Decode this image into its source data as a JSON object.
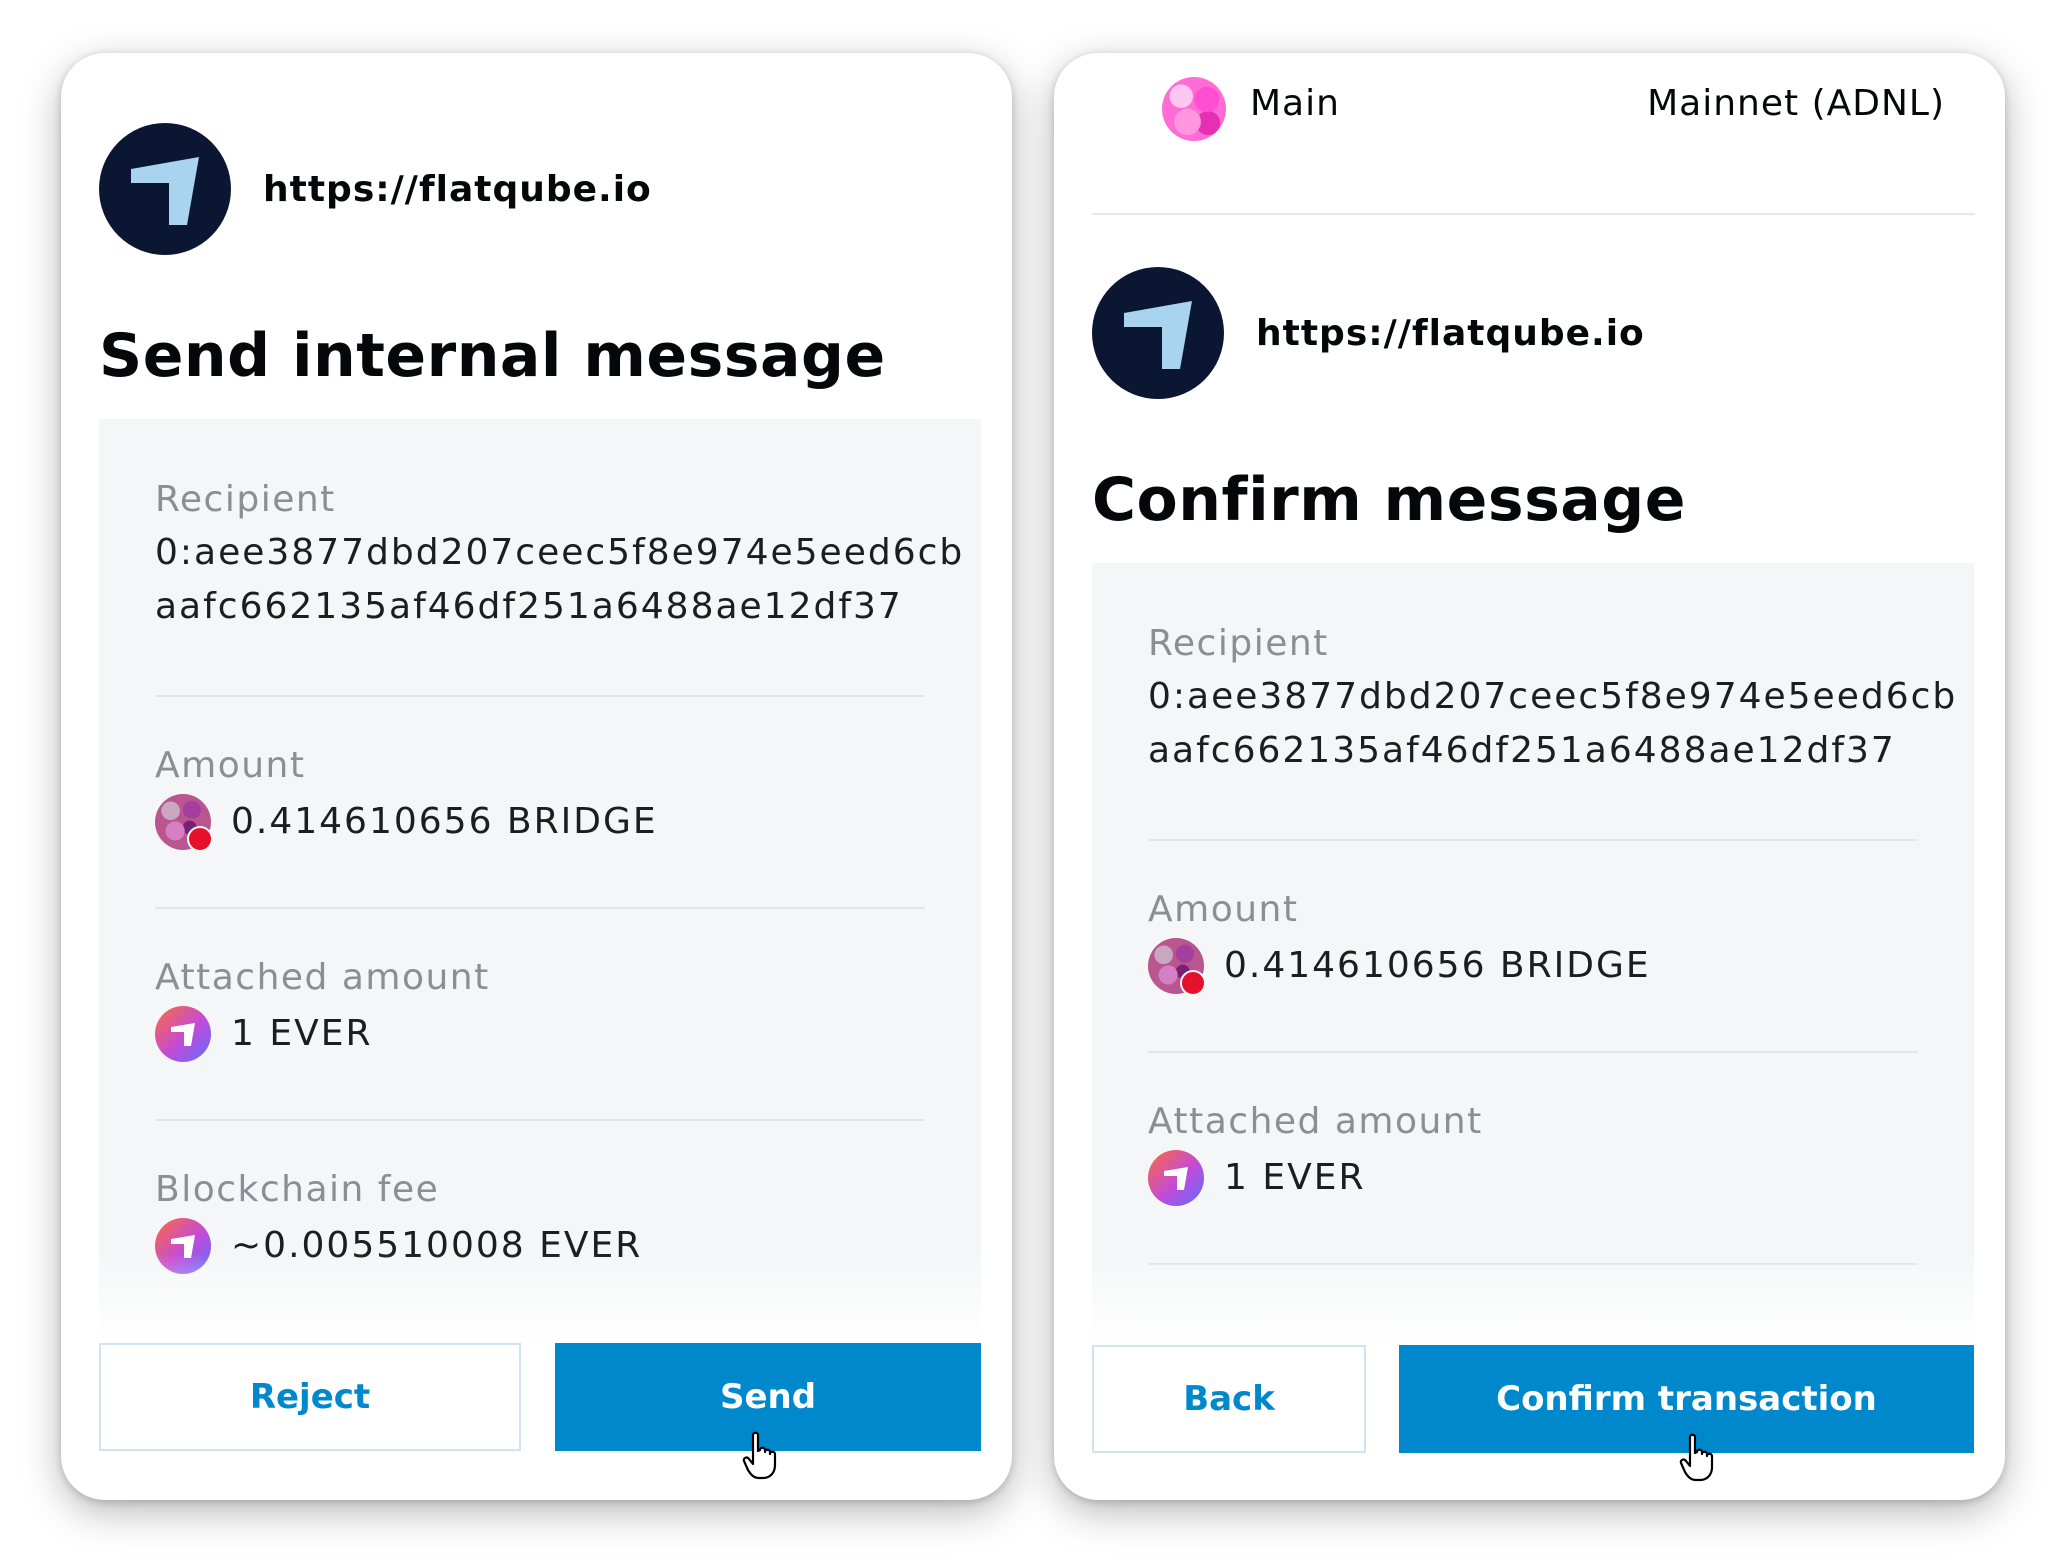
{
  "left_card": {
    "site_url": "https://flatqube.io",
    "title": "Send internal message",
    "recipient_label": "Recipient",
    "recipient_line1": "0:aee3877dbd207ceec5f8e974e5eed6cb",
    "recipient_line2": "aafc662135af46df251a6488ae12df37",
    "amount_label": "Amount",
    "amount_value": "0.414610656 BRIDGE",
    "attached_label": "Attached amount",
    "attached_value": "1 EVER",
    "fee_label": "Blockchain fee",
    "fee_value": "~0.005510008 EVER",
    "reject_label": "Reject",
    "send_label": "Send"
  },
  "right_card": {
    "account_name": "Main",
    "network_name": "Mainnet (ADNL)",
    "site_url": "https://flatqube.io",
    "title": "Confirm message",
    "recipient_label": "Recipient",
    "recipient_line1": "0:aee3877dbd207ceec5f8e974e5eed6cb",
    "recipient_line2": "aafc662135af46df251a6488ae12df37",
    "amount_label": "Amount",
    "amount_value": "0.414610656 BRIDGE",
    "attached_label": "Attached amount",
    "attached_value": "1 EVER",
    "back_label": "Back",
    "confirm_label": "Confirm transaction"
  },
  "icons": {
    "site_logo": "flatqube-logo-icon",
    "bridge_token": "bridge-token-icon",
    "ever_token": "ever-token-icon",
    "account_avatar": "account-avatar",
    "cursor": "hand-pointer-icon"
  },
  "colors": {
    "primary": "#0088cc",
    "panel": "#f5f6f7",
    "label": "#8a8f96",
    "logo_bg": "#0b1633"
  }
}
